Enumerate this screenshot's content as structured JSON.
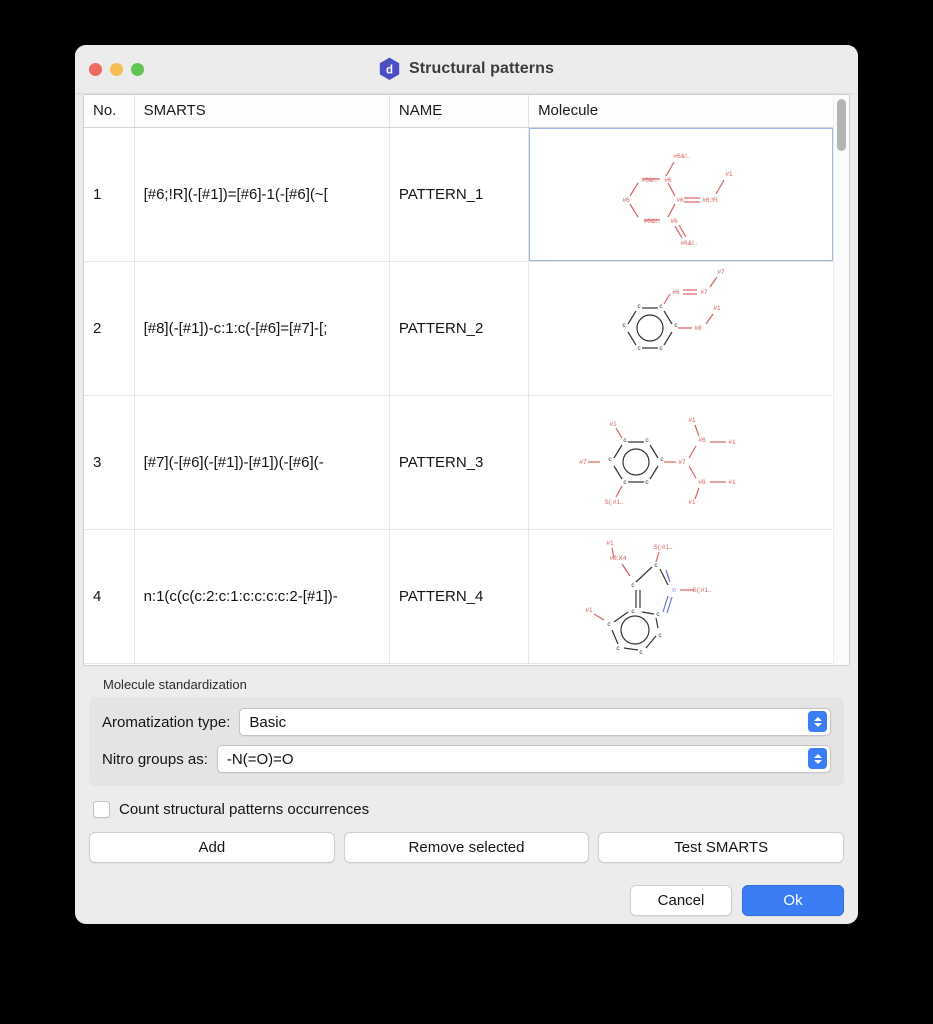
{
  "window": {
    "title": "Structural patterns",
    "app_icon": "hexagon-d-icon",
    "icon_color": "#4a4ec4",
    "traffic_lights": {
      "close": "close-button",
      "minimize": "minimize-button",
      "maximize": "maximize-button",
      "close_color": "#ec6a5f",
      "minimize_color": "#f5bd4f",
      "maximize_color": "#61c554"
    }
  },
  "table": {
    "columns": [
      "No.",
      "SMARTS",
      "NAME",
      "Molecule"
    ],
    "rows": [
      {
        "no": "1",
        "smarts": "[#6;!R](-[#1])=[#6]-1(-[#6](~[",
        "name": "PATTERN_1",
        "molecule_selected": true,
        "molecule_labels": [
          "#6&!..",
          "#6&!..",
          "#6",
          "#6",
          "#6&!..",
          "#6",
          "#6",
          "#6;!R",
          "#1",
          "#6&!.."
        ]
      },
      {
        "no": "2",
        "smarts": "[#8](-[#1])-c:1:c(-[#6]=[#7]-[;",
        "name": "PATTERN_2",
        "molecule_selected": false,
        "molecule_labels": [
          "c",
          "c",
          "c",
          "c",
          "c",
          "c",
          "#6",
          "#7",
          "#7",
          "#8",
          "#1"
        ]
      },
      {
        "no": "3",
        "smarts": "[#7](-[#6](-[#1])-[#1])(-[#6](-",
        "name": "PATTERN_3",
        "molecule_selected": false,
        "molecule_labels": [
          "c",
          "c",
          "c",
          "c",
          "c",
          "c",
          "#1",
          "#1",
          "#7",
          "#7",
          "#6",
          "#1",
          "#6",
          "#1",
          "#1",
          "S(;#1.."
        ]
      },
      {
        "no": "4",
        "smarts": "n:1(c(c(c:2:c:1:c:c:c:c:2-[#1])-",
        "name": "PATTERN_4",
        "molecule_selected": false,
        "molecule_labels": [
          "#1",
          "#8;X4",
          "S(;#1..",
          "c",
          "c",
          "n",
          "S(;#1..",
          "#1",
          "c",
          "c",
          "c",
          "c",
          "c",
          "c"
        ]
      }
    ]
  },
  "scrollbar": {
    "name": "vertical-scrollbar",
    "thumb_color": "#b4b4b4"
  },
  "standardization": {
    "group_label": "Molecule standardization",
    "fields": [
      {
        "label": "Aromatization type:",
        "value": "Basic"
      },
      {
        "label": "Nitro groups as:",
        "value": "-N(=O)=O"
      }
    ]
  },
  "options": {
    "count_checkbox_label": "Count structural patterns occurrences",
    "count_checkbox_checked": false
  },
  "actions": {
    "add": "Add",
    "remove_selected": "Remove selected",
    "test_smarts": "Test SMARTS"
  },
  "footer": {
    "cancel": "Cancel",
    "ok": "Ok",
    "ok_color": "#3b7df4"
  }
}
